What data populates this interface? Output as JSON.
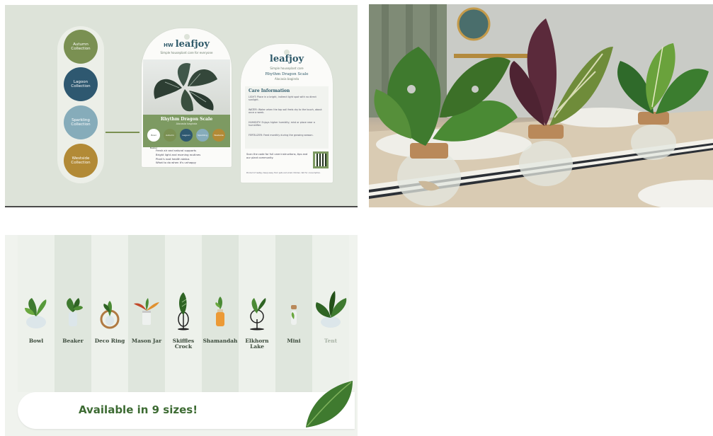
{
  "label_tile": {
    "collections": [
      {
        "label": "Autumn Collection",
        "color": "#7a9052"
      },
      {
        "label": "Lagoon Collection",
        "color": "#2e5870"
      },
      {
        "label": "Sparkling Collection",
        "color": "#86acba"
      },
      {
        "label": "Westside Collection",
        "color": "#b28a36"
      }
    ],
    "tag_front": {
      "brand": "leafjoy",
      "brand_mark": "HW",
      "tagline": "Simple houseplant care for everyone",
      "plant_name": "Rhythm Dragon Scale",
      "plant_sub": "Alocasia baginda",
      "minis": [
        "Bowl Beaker",
        "Autumn",
        "Lagoon",
        "Sparkling",
        "Westside"
      ],
      "list": [
        "Fresh air and natural supports",
        "Bright light and morning routines",
        "Plant's root health status",
        "What to do when it's unhappy"
      ]
    },
    "tag_back": {
      "brand": "leafjoy",
      "tagline": "Simple houseplant care",
      "plant_name": "Rhythm Dragon Scale",
      "plant_sub": "Alocasia baginda",
      "care_title": "Care Information",
      "care_lines": [
        "LIGHT: Place in a bright, indirect light spot with no direct sunlight.",
        "WATER: Water when the top soil feels dry to the touch, about once a week.",
        "HUMIDITY: Enjoys higher humidity; mist or place near a humidifier.",
        "FERTILIZER: Feed monthly during the growing season."
      ],
      "footer": "Scan the code for full care instructions, tips and our plant community.",
      "legal": "Product of leafjoy. Keep away from pets and small children. Not for consumption."
    }
  },
  "sizes_tile": {
    "sizes": [
      {
        "name": "Bowl",
        "faded": false
      },
      {
        "name": "Beaker",
        "faded": false
      },
      {
        "name": "Deco Ring",
        "faded": false
      },
      {
        "name": "Mason Jar",
        "faded": false
      },
      {
        "name": "Skiffles Crock",
        "faded": false
      },
      {
        "name": "Shamandah",
        "faded": false
      },
      {
        "name": "Elkhorn Lake",
        "faded": false
      },
      {
        "name": "Mini",
        "faded": false
      },
      {
        "name": "Tent",
        "faded": true
      }
    ],
    "banner": "Available in 9 sizes!"
  },
  "colors": {
    "brand_green": "#3d6b33",
    "label_bg": "#dde3d9",
    "stripe_dark": "#dfe6dd",
    "stripe_light": "#edf1eb"
  }
}
